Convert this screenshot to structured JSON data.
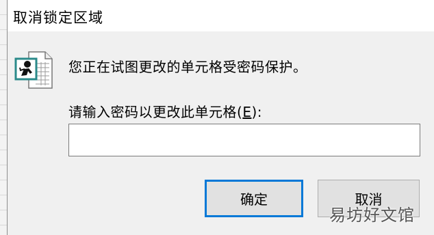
{
  "dialog": {
    "title": "取消锁定区域",
    "icon": "protected-sheet-warning-icon",
    "message": "您正在试图更改的单元格受密码保护。",
    "prompt_text": "请输入密码以更改此单元格(",
    "prompt_mnemonic": "E",
    "prompt_suffix": "):",
    "password_value": "",
    "ok_label": "确定",
    "cancel_label": "取消",
    "accent_color": "#0078d7"
  },
  "watermark": {
    "text": "易坊好文馆"
  }
}
